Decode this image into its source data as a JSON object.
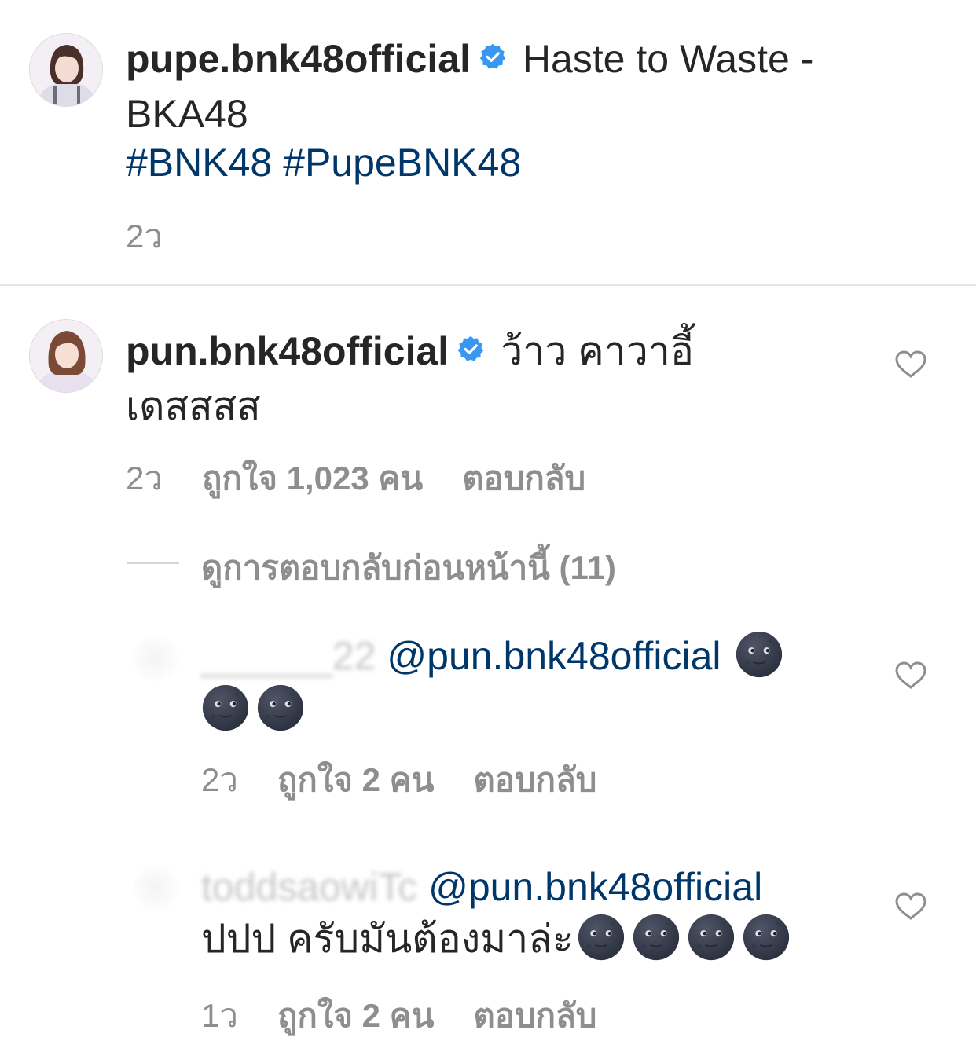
{
  "caption": {
    "username": "pupe.bnk48official",
    "text_line1": "Haste to Waste -",
    "text_line2": "BKA48",
    "hashtags": [
      "#BNK48",
      "#PupeBNK48"
    ],
    "time": "2ว"
  },
  "comment": {
    "username": "pun.bnk48official",
    "text_line1": "ว้าว คาวาอี้",
    "text_line2": "เดสสสส",
    "time": "2ว",
    "likes": "ถูกใจ 1,023 คน",
    "reply": "ตอบกลับ"
  },
  "view_previous_replies": "ดูการตอบกลับก่อนหน้านี้ (11)",
  "replies": [
    {
      "username_blurred": "______22",
      "mention": "@pun.bnk48official",
      "text": "",
      "emoji_count": 3,
      "time": "2ว",
      "likes": "ถูกใจ 2 คน",
      "reply": "ตอบกลับ"
    },
    {
      "username_blurred": "toddsaowiTc",
      "mention": "@pun.bnk48official",
      "text": "ปปป ครับมันต้องมาล่ะ",
      "emoji_count": 4,
      "time": "1ว",
      "likes": "ถูกใจ 2 คน",
      "reply": "ตอบกลับ"
    }
  ],
  "icons": {
    "verified": "verified-badge-icon",
    "heart": "heart-outline-icon",
    "emoji": "new-moon-face-emoji"
  },
  "colors": {
    "text": "#262626",
    "secondary": "#8e8e8e",
    "link": "#00376b",
    "verified": "#3897f0"
  }
}
